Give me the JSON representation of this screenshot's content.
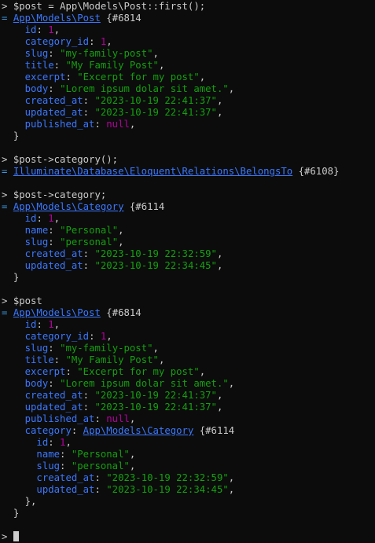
{
  "colors": {
    "background": "#0c0c0c",
    "text": "#cccccc",
    "class_link": "#3b78ff",
    "key": "#3b78ff",
    "string": "#13a10e",
    "number": "#b4009e"
  },
  "lines": [
    {
      "kind": "cmd",
      "prompt": "> ",
      "text": "$post = App\\Models\\Post::first();"
    },
    {
      "kind": "obj",
      "eq": "= ",
      "cls": "App\\Models\\Post",
      "ref": " {#6814",
      "indent": ""
    },
    {
      "kind": "prop",
      "indent": "    ",
      "key": "id",
      "vtype": "num",
      "value": "1",
      "end": ","
    },
    {
      "kind": "prop",
      "indent": "    ",
      "key": "category_id",
      "vtype": "num",
      "value": "1",
      "end": ","
    },
    {
      "kind": "prop",
      "indent": "    ",
      "key": "slug",
      "vtype": "str",
      "value": "\"my-family-post\"",
      "end": ","
    },
    {
      "kind": "prop",
      "indent": "    ",
      "key": "title",
      "vtype": "str",
      "value": "\"My Family Post\"",
      "end": ","
    },
    {
      "kind": "prop",
      "indent": "    ",
      "key": "excerpt",
      "vtype": "str",
      "value": "\"Excerpt for my post\"",
      "end": ","
    },
    {
      "kind": "prop",
      "indent": "    ",
      "key": "body",
      "vtype": "str",
      "value": "\"Lorem ipsum dolar sit amet.\"",
      "end": ","
    },
    {
      "kind": "prop",
      "indent": "    ",
      "key": "created_at",
      "vtype": "str",
      "value": "\"2023-10-19 22:41:37\"",
      "end": ","
    },
    {
      "kind": "prop",
      "indent": "    ",
      "key": "updated_at",
      "vtype": "str",
      "value": "\"2023-10-19 22:41:37\"",
      "end": ","
    },
    {
      "kind": "prop",
      "indent": "    ",
      "key": "published_at",
      "vtype": "nul",
      "value": "null",
      "end": ","
    },
    {
      "kind": "close",
      "indent": "  ",
      "text": "}"
    },
    {
      "kind": "blank"
    },
    {
      "kind": "cmd",
      "prompt": "> ",
      "text": "$post->category();"
    },
    {
      "kind": "obj",
      "eq": "= ",
      "cls": "Illuminate\\Database\\Eloquent\\Relations\\BelongsTo",
      "ref": " {#6108}",
      "indent": ""
    },
    {
      "kind": "blank"
    },
    {
      "kind": "cmd",
      "prompt": "> ",
      "text": "$post->category;"
    },
    {
      "kind": "obj",
      "eq": "= ",
      "cls": "App\\Models\\Category",
      "ref": " {#6114",
      "indent": ""
    },
    {
      "kind": "prop",
      "indent": "    ",
      "key": "id",
      "vtype": "num",
      "value": "1",
      "end": ","
    },
    {
      "kind": "prop",
      "indent": "    ",
      "key": "name",
      "vtype": "str",
      "value": "\"Personal\"",
      "end": ","
    },
    {
      "kind": "prop",
      "indent": "    ",
      "key": "slug",
      "vtype": "str",
      "value": "\"personal\"",
      "end": ","
    },
    {
      "kind": "prop",
      "indent": "    ",
      "key": "created_at",
      "vtype": "str",
      "value": "\"2023-10-19 22:32:59\"",
      "end": ","
    },
    {
      "kind": "prop",
      "indent": "    ",
      "key": "updated_at",
      "vtype": "str",
      "value": "\"2023-10-19 22:34:45\"",
      "end": ","
    },
    {
      "kind": "close",
      "indent": "  ",
      "text": "}"
    },
    {
      "kind": "blank"
    },
    {
      "kind": "cmd",
      "prompt": "> ",
      "text": "$post"
    },
    {
      "kind": "obj",
      "eq": "= ",
      "cls": "App\\Models\\Post",
      "ref": " {#6814",
      "indent": ""
    },
    {
      "kind": "prop",
      "indent": "    ",
      "key": "id",
      "vtype": "num",
      "value": "1",
      "end": ","
    },
    {
      "kind": "prop",
      "indent": "    ",
      "key": "category_id",
      "vtype": "num",
      "value": "1",
      "end": ","
    },
    {
      "kind": "prop",
      "indent": "    ",
      "key": "slug",
      "vtype": "str",
      "value": "\"my-family-post\"",
      "end": ","
    },
    {
      "kind": "prop",
      "indent": "    ",
      "key": "title",
      "vtype": "str",
      "value": "\"My Family Post\"",
      "end": ","
    },
    {
      "kind": "prop",
      "indent": "    ",
      "key": "excerpt",
      "vtype": "str",
      "value": "\"Excerpt for my post\"",
      "end": ","
    },
    {
      "kind": "prop",
      "indent": "    ",
      "key": "body",
      "vtype": "str",
      "value": "\"Lorem ipsum dolar sit amet.\"",
      "end": ","
    },
    {
      "kind": "prop",
      "indent": "    ",
      "key": "created_at",
      "vtype": "str",
      "value": "\"2023-10-19 22:41:37\"",
      "end": ","
    },
    {
      "kind": "prop",
      "indent": "    ",
      "key": "updated_at",
      "vtype": "str",
      "value": "\"2023-10-19 22:41:37\"",
      "end": ","
    },
    {
      "kind": "prop",
      "indent": "    ",
      "key": "published_at",
      "vtype": "nul",
      "value": "null",
      "end": ","
    },
    {
      "kind": "propobj",
      "indent": "    ",
      "key": "category",
      "cls": "App\\Models\\Category",
      "ref": " {#6114"
    },
    {
      "kind": "prop",
      "indent": "      ",
      "key": "id",
      "vtype": "num",
      "value": "1",
      "end": ","
    },
    {
      "kind": "prop",
      "indent": "      ",
      "key": "name",
      "vtype": "str",
      "value": "\"Personal\"",
      "end": ","
    },
    {
      "kind": "prop",
      "indent": "      ",
      "key": "slug",
      "vtype": "str",
      "value": "\"personal\"",
      "end": ","
    },
    {
      "kind": "prop",
      "indent": "      ",
      "key": "created_at",
      "vtype": "str",
      "value": "\"2023-10-19 22:32:59\"",
      "end": ","
    },
    {
      "kind": "prop",
      "indent": "      ",
      "key": "updated_at",
      "vtype": "str",
      "value": "\"2023-10-19 22:34:45\"",
      "end": ","
    },
    {
      "kind": "close",
      "indent": "    ",
      "text": "},"
    },
    {
      "kind": "close",
      "indent": "  ",
      "text": "}"
    },
    {
      "kind": "blank"
    },
    {
      "kind": "prompt",
      "prompt": "> "
    }
  ]
}
